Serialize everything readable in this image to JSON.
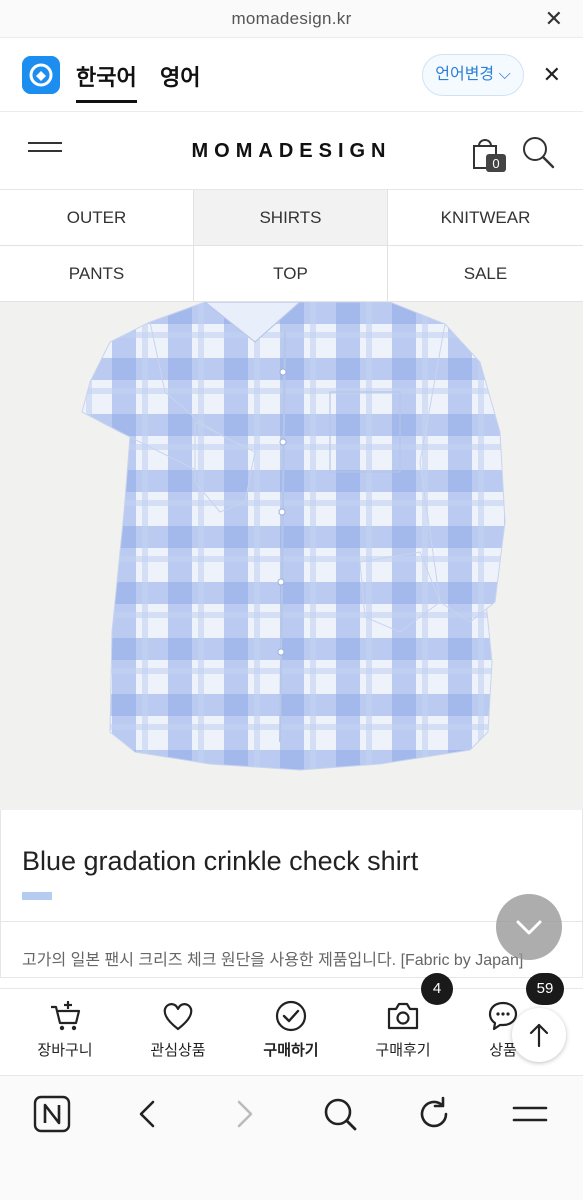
{
  "browser": {
    "url": "momadesign.kr"
  },
  "translate_bar": {
    "source_lang": "한국어",
    "target_lang": "영어",
    "change_button": "언어변경",
    "change_chevron": "⌵"
  },
  "site": {
    "brand": "MOMADESIGN",
    "cart_count": "0"
  },
  "categories": [
    {
      "label": "OUTER",
      "active": false
    },
    {
      "label": "SHIRTS",
      "active": true
    },
    {
      "label": "KNITWEAR",
      "active": false
    },
    {
      "label": "PANTS",
      "active": false
    },
    {
      "label": "TOP",
      "active": false
    },
    {
      "label": "SALE",
      "active": false
    }
  ],
  "product": {
    "title": "Blue gradation crinkle check shirt",
    "description": "고가의 일본 팬시 크리즈 체크 원단을 사용한 제품입니다. [Fabric by Japan]",
    "image_subject": "blue and white plaid crinkle shirt",
    "accent_color": "#b5cbef"
  },
  "action_bar": {
    "items": [
      {
        "label": "장바구니",
        "icon": "cart-plus-icon"
      },
      {
        "label": "관심상품",
        "icon": "heart-icon"
      },
      {
        "label": "구매하기",
        "icon": "check-circle-icon"
      },
      {
        "label": "구매후기",
        "icon": "camera-icon"
      },
      {
        "label": "상품",
        "icon": "chat-icon"
      }
    ],
    "review_count": "4",
    "qna_count": "59"
  },
  "nav_icons": [
    "naver-home-icon",
    "back-icon",
    "forward-icon",
    "search-icon",
    "refresh-icon",
    "menu-icon"
  ]
}
